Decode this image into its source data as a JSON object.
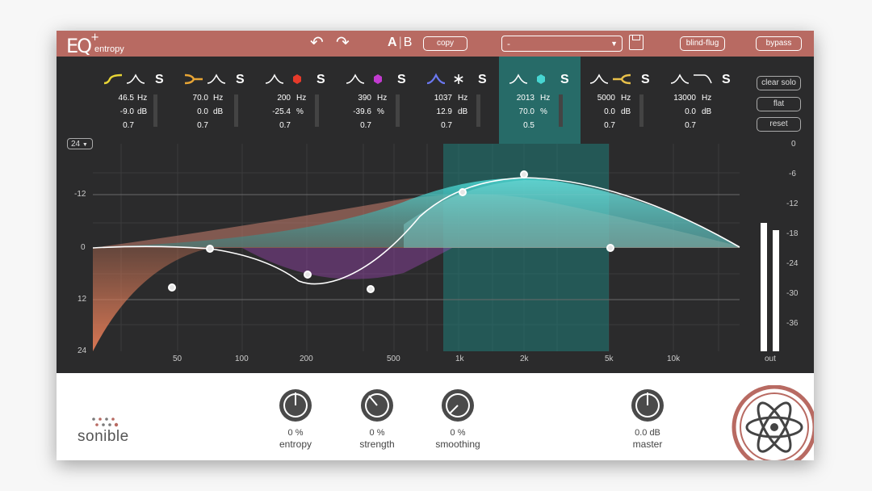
{
  "app": {
    "logo_text": "EQ",
    "logo_sup": "+",
    "logo_sub": "entropy",
    "ab_a": "A",
    "ab_b": "B",
    "copy_label": "copy",
    "preset_value": "-",
    "blind_flug_label": "blind-flug",
    "bypass_label": "bypass"
  },
  "accent": {
    "header": "#b86a62",
    "teal": "#47d6d2",
    "solo_highlight": "#276b68"
  },
  "bands": [
    {
      "filter_left": "highshelf-yellow-icon",
      "filter_right": "bell-icon",
      "freq": "46.5",
      "freq_unit": "Hz",
      "gain": "-9.0",
      "gain_unit": "dB",
      "q": "0.7",
      "solo": "S"
    },
    {
      "filter_left": "notch-orange-icon",
      "filter_right": "bell-icon",
      "freq": "70.0",
      "freq_unit": "Hz",
      "gain": "0.0",
      "gain_unit": "dB",
      "q": "0.7",
      "solo": "S"
    },
    {
      "filter_left": "bell-icon",
      "filter_right": "hexagon-red-icon",
      "freq": "200",
      "freq_unit": "Hz",
      "gain": "-25.4",
      "gain_unit": "%",
      "q": "0.7",
      "solo": "S"
    },
    {
      "filter_left": "bell-icon",
      "filter_right": "hexagon-purple-icon",
      "freq": "390",
      "freq_unit": "Hz",
      "gain": "-39.6",
      "gain_unit": "%",
      "q": "0.7",
      "solo": "S"
    },
    {
      "filter_left": "bell-blue-icon",
      "filter_right": "snowflake-icon",
      "freq": "1037",
      "freq_unit": "Hz",
      "gain": "12.9",
      "gain_unit": "dB",
      "q": "0.7",
      "solo": "S"
    },
    {
      "filter_left": "bell-icon",
      "filter_right": "hexagon-teal-icon",
      "freq": "2013",
      "freq_unit": "Hz",
      "gain": "70.0",
      "gain_unit": "%",
      "q": "0.5",
      "solo": "S"
    },
    {
      "filter_left": "bell-icon",
      "filter_right": "lowshelf-yellow-icon",
      "freq": "5000",
      "freq_unit": "Hz",
      "gain": "0.0",
      "gain_unit": "dB",
      "q": "0.7",
      "solo": "S"
    },
    {
      "filter_left": "bell-icon",
      "filter_right": "highcut-icon",
      "freq": "13000",
      "freq_unit": "Hz",
      "gain": "0.0",
      "gain_unit": "dB",
      "q": "0.7",
      "solo": "S"
    }
  ],
  "side_buttons": {
    "clear_solo": "clear solo",
    "flat": "flat",
    "reset": "reset"
  },
  "graph": {
    "range_dropdown": "24",
    "gain_labels": [
      "-12",
      "0",
      "12",
      "24"
    ],
    "freq_labels": [
      "50",
      "100",
      "200",
      "500",
      "1k",
      "2k",
      "5k",
      "10k"
    ],
    "meter_labels": [
      "0",
      "-6",
      "-12",
      "-18",
      "-24",
      "-30",
      "-36"
    ],
    "meter_out_label": "out"
  },
  "knobs": [
    {
      "value": "0 %",
      "label": "entropy"
    },
    {
      "value": "0 %",
      "label": "strength"
    },
    {
      "value": "0 %",
      "label": "smoothing"
    },
    {
      "value": "0.0 dB",
      "label": "master"
    }
  ],
  "brand": {
    "name": "sonible"
  }
}
